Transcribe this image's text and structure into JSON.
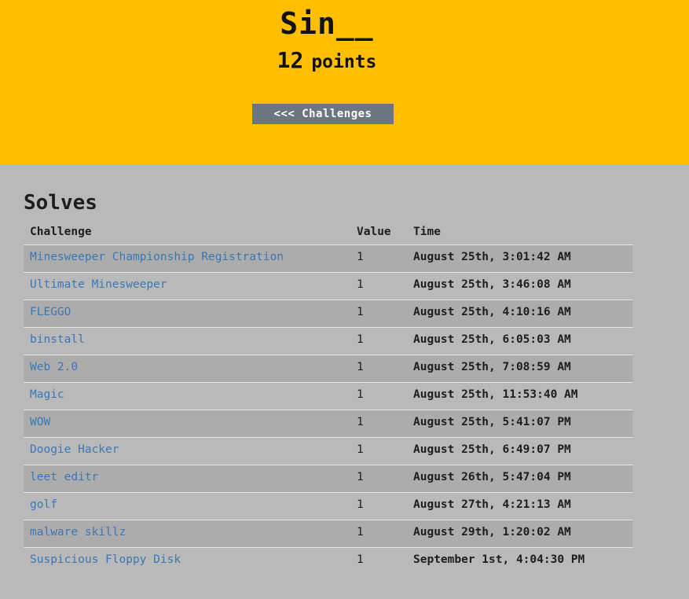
{
  "header": {
    "user_name": "Sin__",
    "score": "12",
    "score_unit": "points",
    "back_button": "<<< Challenges"
  },
  "solves": {
    "title": "Solves",
    "columns": [
      "Challenge",
      "Value",
      "Time"
    ],
    "rows": [
      {
        "challenge": "Minesweeper Championship Registration",
        "value": "1",
        "time": "August 25th, 3:01:42 AM"
      },
      {
        "challenge": "Ultimate Minesweeper",
        "value": "1",
        "time": "August 25th, 3:46:08 AM"
      },
      {
        "challenge": "FLEGGO",
        "value": "1",
        "time": "August 25th, 4:10:16 AM"
      },
      {
        "challenge": "binstall",
        "value": "1",
        "time": "August 25th, 6:05:03 AM"
      },
      {
        "challenge": "Web 2.0",
        "value": "1",
        "time": "August 25th, 7:08:59 AM"
      },
      {
        "challenge": "Magic",
        "value": "1",
        "time": "August 25th, 11:53:40 AM"
      },
      {
        "challenge": "WOW",
        "value": "1",
        "time": "August 25th, 5:41:07 PM"
      },
      {
        "challenge": "Doogie Hacker",
        "value": "1",
        "time": "August 25th, 6:49:07 PM"
      },
      {
        "challenge": "leet editr",
        "value": "1",
        "time": "August 26th, 5:47:04 PM"
      },
      {
        "challenge": "golf",
        "value": "1",
        "time": "August 27th, 4:21:13 AM"
      },
      {
        "challenge": "malware skillz",
        "value": "1",
        "time": "August 29th, 1:20:02 AM"
      },
      {
        "challenge": "Suspicious Floppy Disk",
        "value": "1",
        "time": "September 1st, 4:04:30 PM"
      }
    ]
  },
  "colors": {
    "header_bg": "#ffbf00",
    "page_bg": "#b9b9b9",
    "row_stripe": "#acacac",
    "button_bg": "#6c7680",
    "link": "#3a78b6"
  }
}
